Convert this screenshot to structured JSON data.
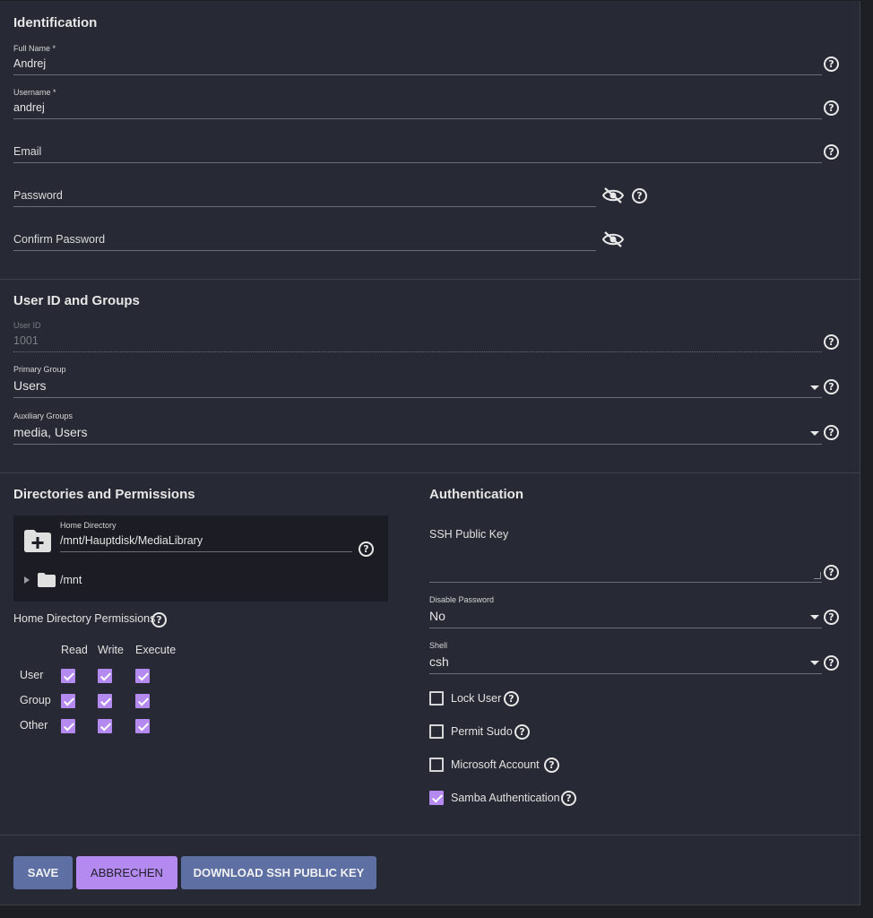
{
  "identification": {
    "title": "Identification",
    "full_name_label": "Full Name *",
    "full_name_value": "Andrej",
    "username_label": "Username *",
    "username_value": "andrej",
    "email_label": "Email",
    "password_label": "Password",
    "confirm_password_label": "Confirm Password"
  },
  "user_id_groups": {
    "title": "User ID and Groups",
    "user_id_label": "User ID",
    "user_id_value": "1001",
    "primary_group_label": "Primary Group",
    "primary_group_value": "Users",
    "aux_groups_label": "Auxiliary Groups",
    "aux_groups_value": "media, Users"
  },
  "directories": {
    "title": "Directories and Permissions",
    "home_dir_label": "Home Directory",
    "home_dir_value": "/mnt/Hauptdisk/MediaLibrary",
    "tree_node": "/mnt",
    "permissions_label": "Home Directory Permissions",
    "columns": [
      "Read",
      "Write",
      "Execute"
    ],
    "rows": [
      {
        "name": "User",
        "read": true,
        "write": true,
        "execute": true
      },
      {
        "name": "Group",
        "read": true,
        "write": true,
        "execute": true
      },
      {
        "name": "Other",
        "read": true,
        "write": true,
        "execute": true
      }
    ]
  },
  "authentication": {
    "title": "Authentication",
    "ssh_key_label": "SSH Public Key",
    "disable_password_label": "Disable Password",
    "disable_password_value": "No",
    "shell_label": "Shell",
    "shell_value": "csh",
    "checkboxes": [
      {
        "label": "Lock User",
        "checked": false
      },
      {
        "label": "Permit Sudo",
        "checked": false
      },
      {
        "label": "Microsoft Account",
        "checked": false
      },
      {
        "label": "Samba Authentication",
        "checked": true
      }
    ]
  },
  "buttons": {
    "save": "SAVE",
    "cancel": "ABBRECHEN",
    "download": "DOWNLOAD SSH PUBLIC KEY"
  },
  "colors": {
    "accent": "#b48af0",
    "primary_button": "#5d6fa3",
    "card_background": "#272934"
  },
  "icons": {
    "help": "?"
  }
}
